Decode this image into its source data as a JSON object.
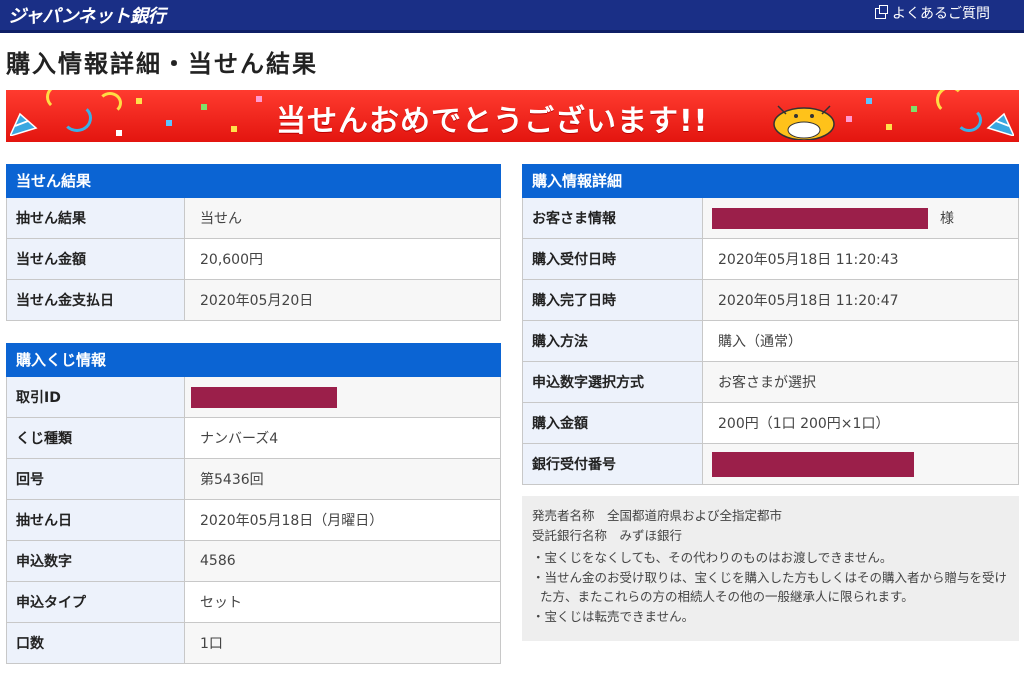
{
  "header": {
    "logo": "ジャパンネット銀行",
    "faq_label": "よくあるご質問"
  },
  "page_title": "購入情報詳細・当せん結果",
  "banner": {
    "text": "当せんおめでとうございます!!"
  },
  "winning_result": {
    "title": "当せん結果",
    "rows": [
      {
        "label": "抽せん結果",
        "value": "当せん"
      },
      {
        "label": "当せん金額",
        "value": "20,600円"
      },
      {
        "label": "当せん金支払日",
        "value": "2020年05月20日"
      }
    ]
  },
  "lottery_info": {
    "title": "購入くじ情報",
    "rows": [
      {
        "label": "取引ID",
        "value": ""
      },
      {
        "label": "くじ種類",
        "value": "ナンバーズ4"
      },
      {
        "label": "回号",
        "value": "第5436回"
      },
      {
        "label": "抽せん日",
        "value": "2020年05月18日（月曜日）"
      },
      {
        "label": "申込数字",
        "value": "4586"
      },
      {
        "label": "申込タイプ",
        "value": "セット"
      },
      {
        "label": "口数",
        "value": "1口"
      }
    ]
  },
  "purchase_details": {
    "title": "購入情報詳細",
    "honorific": "様",
    "rows": [
      {
        "label": "お客さま情報",
        "value": ""
      },
      {
        "label": "購入受付日時",
        "value": "2020年05月18日 11:20:43"
      },
      {
        "label": "購入完了日時",
        "value": "2020年05月18日 11:20:47"
      },
      {
        "label": "購入方法",
        "value": "購入（通常）"
      },
      {
        "label": "申込数字選択方式",
        "value": "お客さまが選択"
      },
      {
        "label": "購入金額",
        "value": "200円（1口 200円×1口）"
      },
      {
        "label": "銀行受付番号",
        "value": ""
      }
    ]
  },
  "notes": {
    "seller": "発売者名称　全国都道府県および全指定都市",
    "bank": "受託銀行名称　みずほ銀行",
    "items": [
      "・宝くじをなくしても、その代わりのものはお渡しできません。",
      "・当せん金のお受け取りは、宝くじを購入した方もしくはその購入者から贈与を受けた方、またこれらの方の相続人その他の一般継承人に限られます。",
      "・宝くじは転売できません。"
    ]
  },
  "colors": {
    "topbar": "#1a2f86",
    "panel_header": "#0b64d3",
    "label_bg": "#edf2fb",
    "redaction": "#9b1f4a",
    "banner": "#e3150f"
  }
}
